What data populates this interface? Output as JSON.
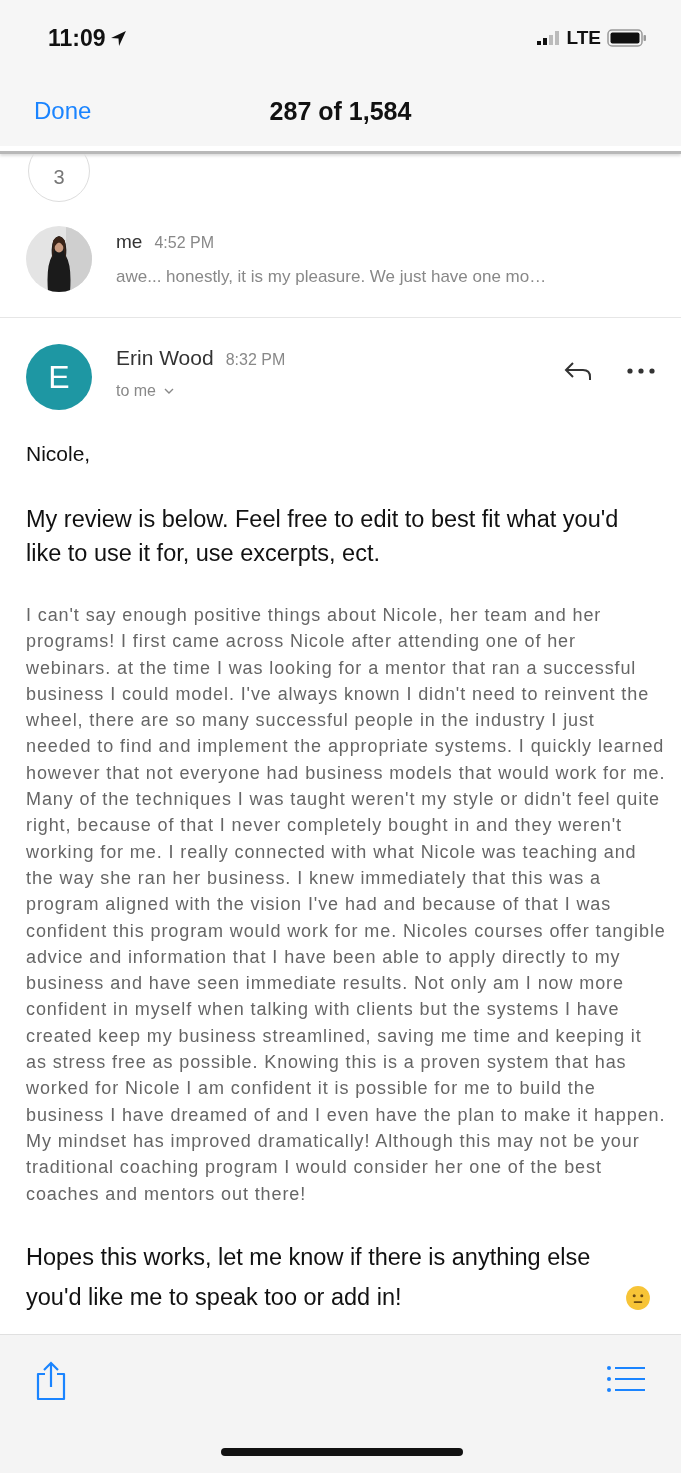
{
  "status_bar": {
    "time": "11:09",
    "network": "LTE"
  },
  "nav": {
    "done": "Done",
    "title": "287 of 1,584"
  },
  "collapsed_count": "3",
  "previous_message": {
    "sender": "me",
    "time": "4:52 PM",
    "snippet": "awe... honestly, it is my pleasure. We just have one mo…"
  },
  "open_message": {
    "sender": "Erin Wood",
    "initial": "E",
    "time": "8:32 PM",
    "recipient": "to me",
    "body": [
      {
        "kind": "greeting",
        "text": "Nicole,"
      },
      {
        "kind": "lead",
        "text": "My review is below. Feel free to edit to best fit what you'd like to use it for, use excerpts, ect."
      },
      {
        "kind": "review",
        "text": "I can't say enough positive things about Nicole, her team and her programs!  I first came across Nicole after attending one of her webinars.  at the time I was looking for a mentor that ran a successful business I could model. I've always known I didn't need to reinvent the wheel, there are so many successful people in the industry I just needed to find and implement the appropriate systems. I quickly learned however that not everyone had business models that would work for me. Many of the techniques I was taught weren't my style or didn't feel quite right, because of that I never completely bought in and they weren't working for me. I really connected with what Nicole was teaching and the way she ran her business. I knew immediately that this was a program aligned with the vision I've had and because of that I was confident this program would work for me.  Nicoles courses offer tangible advice and information that I have been able to apply directly to my business and have seen immediate results. Not only am I now more confident in myself when talking with clients but the systems I have created keep my business streamlined, saving me time and keeping it as stress free as possible. Knowing this is a proven system that has worked for Nicole I am confident it is possible for me to build the business I have dreamed of and I even have the plan to make it happen. My mindset has improved dramatically! Although this may not be your traditional coaching program I would consider her one of the best coaches and mentors out there!"
      },
      {
        "kind": "closing",
        "text": "Hopes this works, let me know if there is anything else you'd like me to speak too or add in!",
        "emoji": true
      }
    ]
  }
}
